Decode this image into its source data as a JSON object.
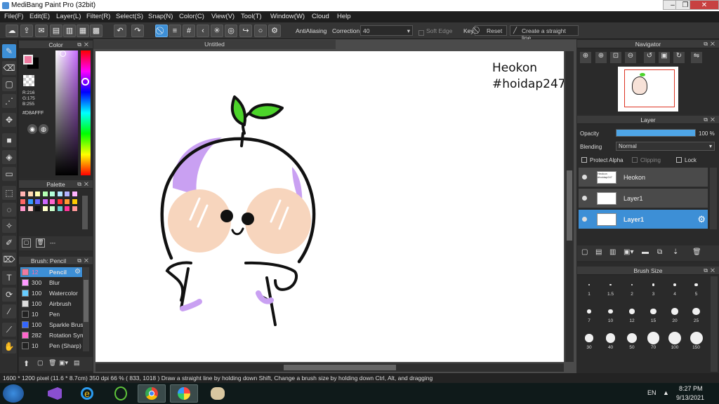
{
  "window": {
    "title": "MediBang Paint Pro (32bit)"
  },
  "menu": [
    "File(F)",
    "Edit(E)",
    "Layer(L)",
    "Filter(R)",
    "Select(S)",
    "Snap(N)",
    "Color(C)",
    "View(V)",
    "Tool(T)",
    "Window(W)",
    "Cloud",
    "Help"
  ],
  "toolbar": {
    "antialiasing_label": "AntiAliasing",
    "correction_label": "Correction",
    "correction_value": "40",
    "soft_edge_label": "Soft Edge",
    "key_label": "Key",
    "reset_label": "Reset",
    "straight_line_label": "Create a straight line"
  },
  "color_panel": {
    "title": "Color",
    "r": "R:216",
    "g": "G:175",
    "b": "B:255",
    "hex": "#D8AFFF",
    "fg_color": "#f07aa0",
    "bg_color": "#000000"
  },
  "palette_panel": {
    "title": "Palette",
    "placeholder": "---",
    "swatches": [
      "#ffb3b3",
      "#ffd9b3",
      "#ffffb3",
      "#b3ffb3",
      "#b3ffd9",
      "#b3e6ff",
      "#b3b3ff",
      "#ffb3ff",
      "#ff6666",
      "#3399ff",
      "#6666ff",
      "#cc66ff",
      "#ff66cc",
      "#ff3333",
      "#ff9933",
      "#ffcc00",
      "#ff99cc",
      "#ffcccc",
      "#111111",
      "#ffffcc",
      "#ccffcc",
      "#66cccc",
      "#ff3399",
      "#ff9999"
    ]
  },
  "brush_panel": {
    "title": "Brush: Pencil",
    "brushes": [
      {
        "size": "12",
        "name": "Pencil",
        "color": "#f07aa0",
        "selected": true
      },
      {
        "size": "300",
        "name": "Blur",
        "color": "#ff99ff",
        "selected": false
      },
      {
        "size": "100",
        "name": "Watercolor",
        "color": "#66ccff",
        "selected": false
      },
      {
        "size": "100",
        "name": "Airbrush",
        "color": "#dddddd",
        "selected": false
      },
      {
        "size": "10",
        "name": "Pen",
        "color": "#222222",
        "selected": false
      },
      {
        "size": "100",
        "name": "Sparkle Brush",
        "color": "#3366ff",
        "selected": false
      },
      {
        "size": "282",
        "name": "Rotation Sym",
        "color": "#ff66cc",
        "selected": false
      },
      {
        "size": "10",
        "name": "Pen (Sharp)",
        "color": "#222222",
        "selected": false
      }
    ]
  },
  "document": {
    "tab_title": "Untitled"
  },
  "canvas_text": {
    "line1": "Heokon",
    "line2": "#hoidap247"
  },
  "navigator": {
    "title": "Navigator"
  },
  "layer_panel": {
    "title": "Layer",
    "opacity_label": "Opacity",
    "opacity_value": "100 %",
    "opacity_fraction": 1.0,
    "blending_label": "Blending",
    "blending_value": "Normal",
    "protect_alpha_label": "Protect Alpha",
    "clipping_label": "Clipping",
    "lock_label": "Lock",
    "layers": [
      {
        "name": "Heokon",
        "selected": false,
        "thumb_text": "Heokon #hoidap247"
      },
      {
        "name": "Layer1",
        "selected": false,
        "thumb_text": ""
      },
      {
        "name": "Layer1",
        "selected": true,
        "thumb_text": ""
      }
    ]
  },
  "brush_size_panel": {
    "title": "Brush Size",
    "sizes": [
      "1",
      "1.5",
      "2",
      "3",
      "4",
      "5",
      "7",
      "10",
      "12",
      "15",
      "20",
      "25",
      "30",
      "40",
      "50",
      "70",
      "100",
      "150"
    ]
  },
  "status": {
    "text": "1600 * 1200 pixel   (11.6 * 8.7cm)   350 dpi   66 %   ( 833, 1018 )   Draw a straight line by holding down Shift, Change a brush size by holding down Ctrl, Alt, and dragging"
  },
  "taskbar": {
    "lang": "EN",
    "time": "8:27 PM",
    "date": "9/13/2021"
  }
}
